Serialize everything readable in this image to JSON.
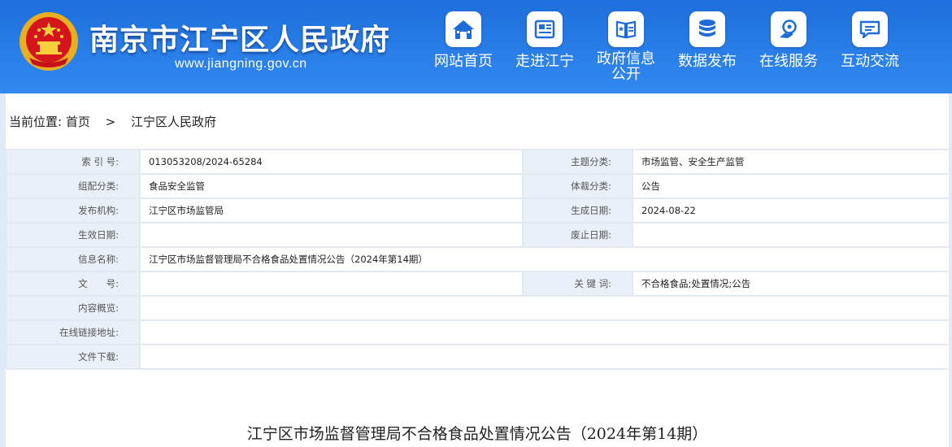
{
  "header": {
    "site_title": "南京市江宁区人民政府",
    "site_url": "www.jiangning.gov.cn",
    "emblem_icon": "national-emblem-icon",
    "nav": [
      {
        "label": "网站首页",
        "icon": "home-icon"
      },
      {
        "label": "走进江宁",
        "icon": "newspaper-icon"
      },
      {
        "label": "政府信息公开",
        "icon": "book-icon"
      },
      {
        "label": "数据发布",
        "icon": "database-icon"
      },
      {
        "label": "在线服务",
        "icon": "service-icon"
      },
      {
        "label": "互动交流",
        "icon": "chat-icon"
      }
    ]
  },
  "breadcrumb": {
    "prefix": "当前位置:",
    "home": "首页",
    "separator": ">",
    "current": "江宁区人民政府"
  },
  "meta": {
    "index_label": "索 引 号:",
    "index_value": "013053208/2024-65284",
    "topic_label": "主题分类:",
    "topic_value": "市场监管、安全生产监管",
    "org_label": "组配分类:",
    "org_value": "食品安全监管",
    "genre_label": "体裁分类:",
    "genre_value": "公告",
    "publisher_label": "发布机构:",
    "publisher_value": "江宁区市场监管局",
    "created_label": "生成日期:",
    "created_value": "2024-08-22",
    "effective_label": "生效日期:",
    "effective_value": "",
    "expire_label": "废止日期:",
    "expire_value": "",
    "name_label": "信息名称:",
    "name_value": "江宁区市场监督管理局不合格食品处置情况公告（2024年第14期）",
    "docno_label": "文　　号:",
    "docno_value": "",
    "keywords_label": "关 键 词:",
    "keywords_value": "不合格食品;处置情况;公告",
    "summary_label": "内容概览:",
    "summary_value": "",
    "link_label": "在线链接地址:",
    "link_value": "",
    "download_label": "文件下载:",
    "download_value": ""
  },
  "document": {
    "title": "江宁区市场监督管理局不合格食品处置情况公告（2024年第14期）"
  },
  "colors": {
    "header_blue": "#2a7fe9",
    "label_bg": "#e9f0f8",
    "border": "#e3e9f0"
  }
}
